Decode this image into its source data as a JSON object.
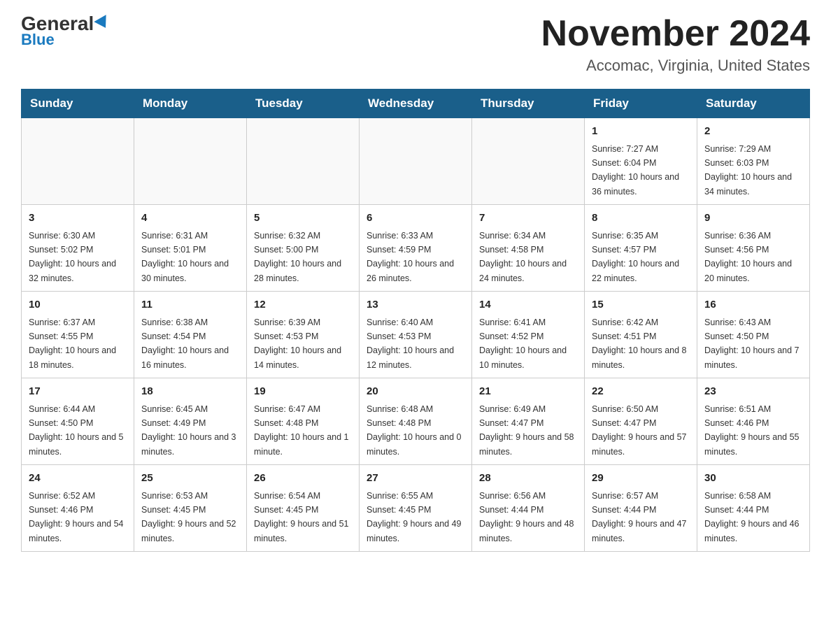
{
  "logo": {
    "general": "General",
    "blue": "Blue"
  },
  "title": "November 2024",
  "subtitle": "Accomac, Virginia, United States",
  "weekdays": [
    "Sunday",
    "Monday",
    "Tuesday",
    "Wednesday",
    "Thursday",
    "Friday",
    "Saturday"
  ],
  "weeks": [
    [
      {
        "day": "",
        "info": ""
      },
      {
        "day": "",
        "info": ""
      },
      {
        "day": "",
        "info": ""
      },
      {
        "day": "",
        "info": ""
      },
      {
        "day": "",
        "info": ""
      },
      {
        "day": "1",
        "info": "Sunrise: 7:27 AM\nSunset: 6:04 PM\nDaylight: 10 hours and 36 minutes."
      },
      {
        "day": "2",
        "info": "Sunrise: 7:29 AM\nSunset: 6:03 PM\nDaylight: 10 hours and 34 minutes."
      }
    ],
    [
      {
        "day": "3",
        "info": "Sunrise: 6:30 AM\nSunset: 5:02 PM\nDaylight: 10 hours and 32 minutes."
      },
      {
        "day": "4",
        "info": "Sunrise: 6:31 AM\nSunset: 5:01 PM\nDaylight: 10 hours and 30 minutes."
      },
      {
        "day": "5",
        "info": "Sunrise: 6:32 AM\nSunset: 5:00 PM\nDaylight: 10 hours and 28 minutes."
      },
      {
        "day": "6",
        "info": "Sunrise: 6:33 AM\nSunset: 4:59 PM\nDaylight: 10 hours and 26 minutes."
      },
      {
        "day": "7",
        "info": "Sunrise: 6:34 AM\nSunset: 4:58 PM\nDaylight: 10 hours and 24 minutes."
      },
      {
        "day": "8",
        "info": "Sunrise: 6:35 AM\nSunset: 4:57 PM\nDaylight: 10 hours and 22 minutes."
      },
      {
        "day": "9",
        "info": "Sunrise: 6:36 AM\nSunset: 4:56 PM\nDaylight: 10 hours and 20 minutes."
      }
    ],
    [
      {
        "day": "10",
        "info": "Sunrise: 6:37 AM\nSunset: 4:55 PM\nDaylight: 10 hours and 18 minutes."
      },
      {
        "day": "11",
        "info": "Sunrise: 6:38 AM\nSunset: 4:54 PM\nDaylight: 10 hours and 16 minutes."
      },
      {
        "day": "12",
        "info": "Sunrise: 6:39 AM\nSunset: 4:53 PM\nDaylight: 10 hours and 14 minutes."
      },
      {
        "day": "13",
        "info": "Sunrise: 6:40 AM\nSunset: 4:53 PM\nDaylight: 10 hours and 12 minutes."
      },
      {
        "day": "14",
        "info": "Sunrise: 6:41 AM\nSunset: 4:52 PM\nDaylight: 10 hours and 10 minutes."
      },
      {
        "day": "15",
        "info": "Sunrise: 6:42 AM\nSunset: 4:51 PM\nDaylight: 10 hours and 8 minutes."
      },
      {
        "day": "16",
        "info": "Sunrise: 6:43 AM\nSunset: 4:50 PM\nDaylight: 10 hours and 7 minutes."
      }
    ],
    [
      {
        "day": "17",
        "info": "Sunrise: 6:44 AM\nSunset: 4:50 PM\nDaylight: 10 hours and 5 minutes."
      },
      {
        "day": "18",
        "info": "Sunrise: 6:45 AM\nSunset: 4:49 PM\nDaylight: 10 hours and 3 minutes."
      },
      {
        "day": "19",
        "info": "Sunrise: 6:47 AM\nSunset: 4:48 PM\nDaylight: 10 hours and 1 minute."
      },
      {
        "day": "20",
        "info": "Sunrise: 6:48 AM\nSunset: 4:48 PM\nDaylight: 10 hours and 0 minutes."
      },
      {
        "day": "21",
        "info": "Sunrise: 6:49 AM\nSunset: 4:47 PM\nDaylight: 9 hours and 58 minutes."
      },
      {
        "day": "22",
        "info": "Sunrise: 6:50 AM\nSunset: 4:47 PM\nDaylight: 9 hours and 57 minutes."
      },
      {
        "day": "23",
        "info": "Sunrise: 6:51 AM\nSunset: 4:46 PM\nDaylight: 9 hours and 55 minutes."
      }
    ],
    [
      {
        "day": "24",
        "info": "Sunrise: 6:52 AM\nSunset: 4:46 PM\nDaylight: 9 hours and 54 minutes."
      },
      {
        "day": "25",
        "info": "Sunrise: 6:53 AM\nSunset: 4:45 PM\nDaylight: 9 hours and 52 minutes."
      },
      {
        "day": "26",
        "info": "Sunrise: 6:54 AM\nSunset: 4:45 PM\nDaylight: 9 hours and 51 minutes."
      },
      {
        "day": "27",
        "info": "Sunrise: 6:55 AM\nSunset: 4:45 PM\nDaylight: 9 hours and 49 minutes."
      },
      {
        "day": "28",
        "info": "Sunrise: 6:56 AM\nSunset: 4:44 PM\nDaylight: 9 hours and 48 minutes."
      },
      {
        "day": "29",
        "info": "Sunrise: 6:57 AM\nSunset: 4:44 PM\nDaylight: 9 hours and 47 minutes."
      },
      {
        "day": "30",
        "info": "Sunrise: 6:58 AM\nSunset: 4:44 PM\nDaylight: 9 hours and 46 minutes."
      }
    ]
  ]
}
